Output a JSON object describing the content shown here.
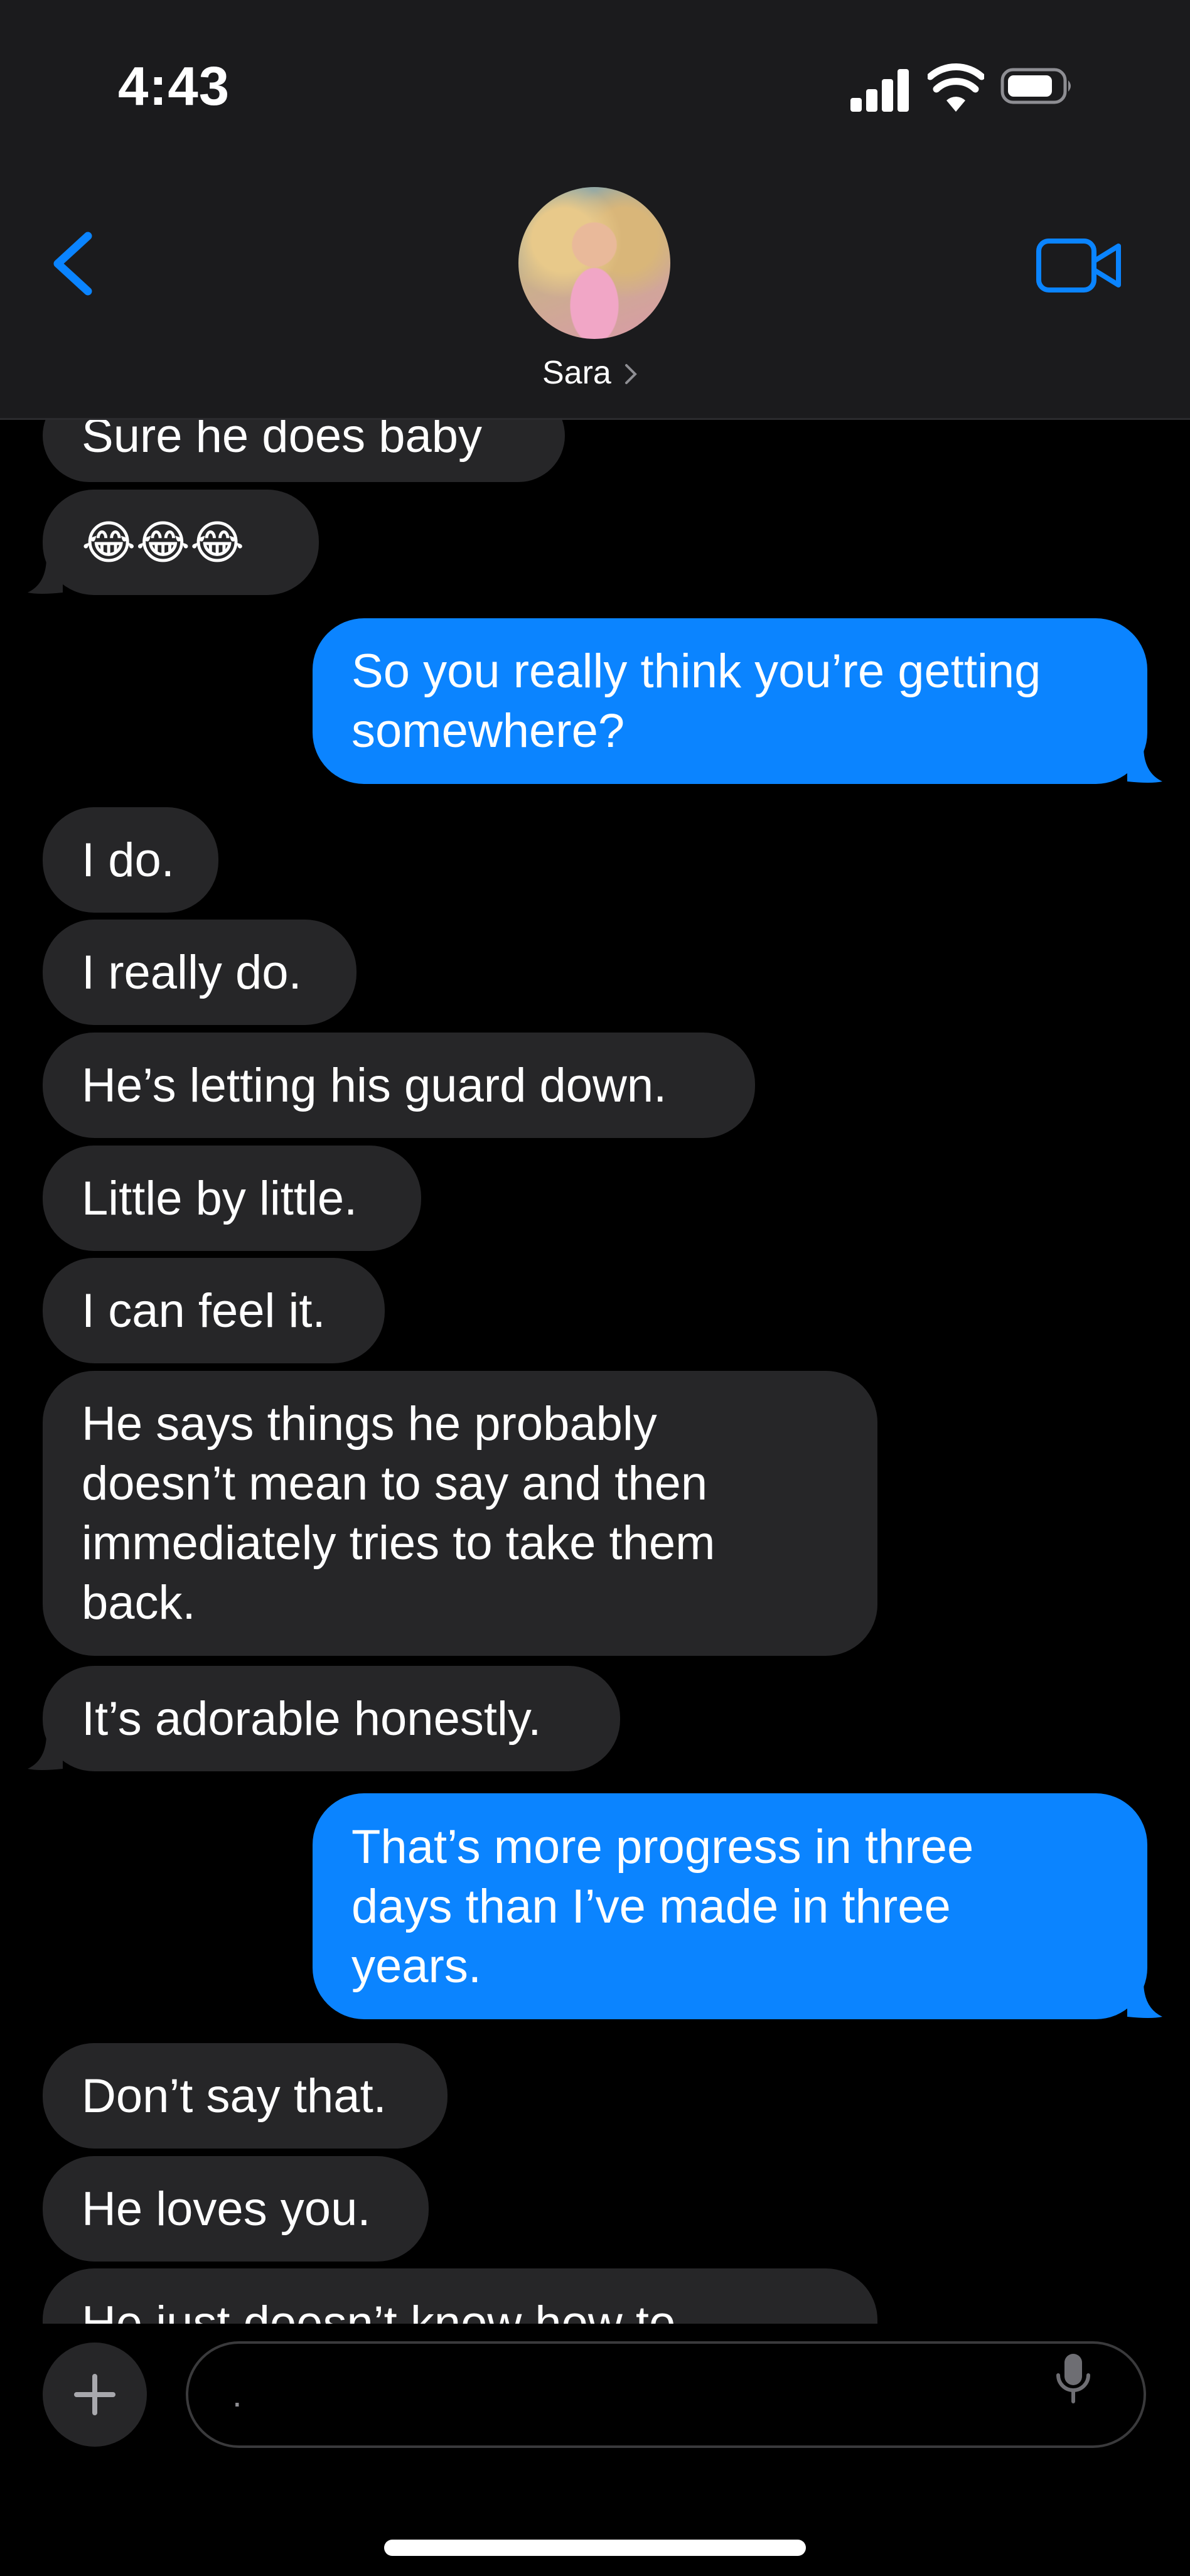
{
  "status_bar": {
    "time": "4:43"
  },
  "header": {
    "contact_name": "Sara"
  },
  "colors": {
    "sent_bubble": "#0b84ff",
    "received_bubble": "#262628",
    "accent": "#0a84ff"
  },
  "messages": [
    {
      "from": "them",
      "text": "Sure he does baby"
    },
    {
      "from": "them",
      "text": "😂😂😂"
    },
    {
      "from": "me",
      "text": "So you really think you’re getting\nsomewhere?"
    },
    {
      "from": "them",
      "text": "I do."
    },
    {
      "from": "them",
      "text": "I really do."
    },
    {
      "from": "them",
      "text": "He’s letting his guard down."
    },
    {
      "from": "them",
      "text": "Little by little."
    },
    {
      "from": "them",
      "text": "I can feel it."
    },
    {
      "from": "them",
      "text": "He says things he probably\ndoesn’t mean to say and then\nimmediately tries to take them\nback."
    },
    {
      "from": "them",
      "text": "It’s adorable honestly."
    },
    {
      "from": "me",
      "text": "That’s more progress in three\ndays than I’ve made in three\nyears."
    },
    {
      "from": "them",
      "text": "Don’t say that."
    },
    {
      "from": "them",
      "text": "He loves you."
    },
    {
      "from": "them",
      "text": "He just doesn’t know how to"
    }
  ],
  "composer": {
    "placeholder": "."
  },
  "icons": {
    "back": "chevron-left-icon",
    "video": "video-camera-icon",
    "plus": "plus-icon",
    "mic": "microphone-icon"
  }
}
